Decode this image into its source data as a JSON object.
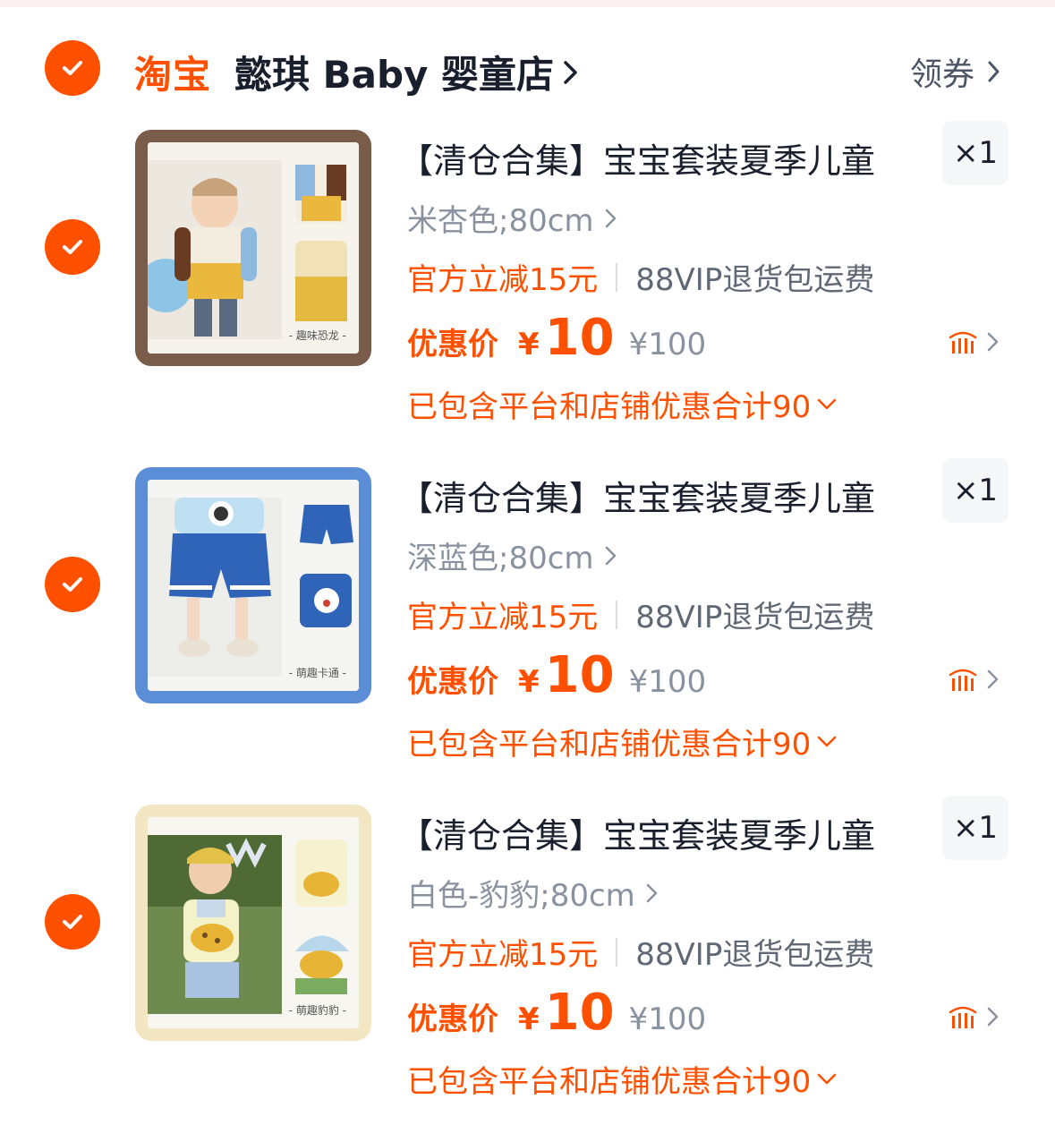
{
  "store": {
    "logo_text": "淘宝",
    "name": "懿琪 Baby 婴童店",
    "coupon_label": "领券"
  },
  "colors": {
    "accent": "#ff5000",
    "text_primary": "#1a1f2e",
    "text_secondary": "#8a919f"
  },
  "items": [
    {
      "title": "【清仓合集】宝宝套装夏季儿童",
      "quantity": "×1",
      "spec": "米杏色;80cm",
      "promo": "官方立减15元",
      "service": "88VIP退货包运费",
      "price_label": "优惠价",
      "price_currency": "¥",
      "price_value": "10",
      "original_price": "¥100",
      "discount_text": "已包含平台和店铺优惠合计90",
      "image_caption": "- 趣味恐龙 -",
      "frame_color": "#7a5c4a"
    },
    {
      "title": "【清仓合集】宝宝套装夏季儿童",
      "quantity": "×1",
      "spec": "深蓝色;80cm",
      "promo": "官方立减15元",
      "service": "88VIP退货包运费",
      "price_label": "优惠价",
      "price_currency": "¥",
      "price_value": "10",
      "original_price": "¥100",
      "discount_text": "已包含平台和店铺优惠合计90",
      "image_caption": "- 萌趣卡通 -",
      "frame_color": "#5b8ed6"
    },
    {
      "title": "【清仓合集】宝宝套装夏季儿童",
      "quantity": "×1",
      "spec": "白色-豹豹;80cm",
      "promo": "官方立减15元",
      "service": "88VIP退货包运费",
      "price_label": "优惠价",
      "price_currency": "¥",
      "price_value": "10",
      "original_price": "¥100",
      "discount_text": "已包含平台和店铺优惠合计90",
      "image_caption": "- 萌趣豹豹 -",
      "frame_color": "#f3e6c2"
    }
  ]
}
